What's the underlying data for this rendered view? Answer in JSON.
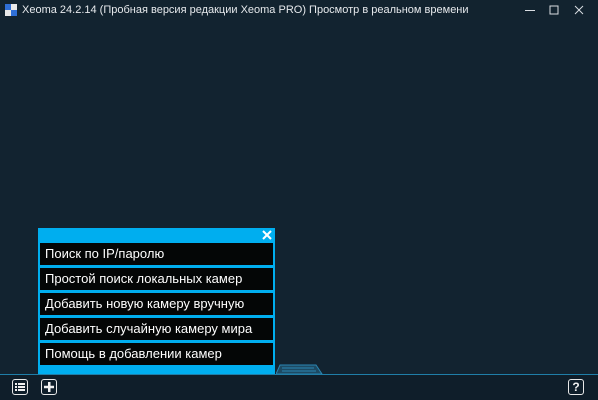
{
  "window": {
    "title": "Xeoma 24.2.14 (Пробная версия редакции Xeoma PRO) Просмотр в реальном времени",
    "app_icon_colors": [
      "#2f6fd6",
      "#e8e8e8",
      "#e8e8e8",
      "#2f6fd6"
    ]
  },
  "controls": {
    "minimize_icon": "minimize-icon",
    "maximize_icon": "maximize-icon",
    "close_icon": "close-icon"
  },
  "popup": {
    "accent_color": "#00aeef",
    "close_icon": "close-icon",
    "items": [
      {
        "label": "Поиск по IP/паролю"
      },
      {
        "label": "Простой поиск локальных камер"
      },
      {
        "label": "Добавить новую камеру вручную"
      },
      {
        "label": "Добавить случайную камеру мира"
      },
      {
        "label": "Помощь в добавлении камер"
      }
    ]
  },
  "toolbar": {
    "list_icon": "list-icon",
    "add_icon": "plus-icon",
    "help_label": "?"
  },
  "colors": {
    "background": "#122330",
    "titlebar": "#12232f",
    "menu_item_bg": "#040606",
    "bottom_border": "#1f7ea8"
  }
}
